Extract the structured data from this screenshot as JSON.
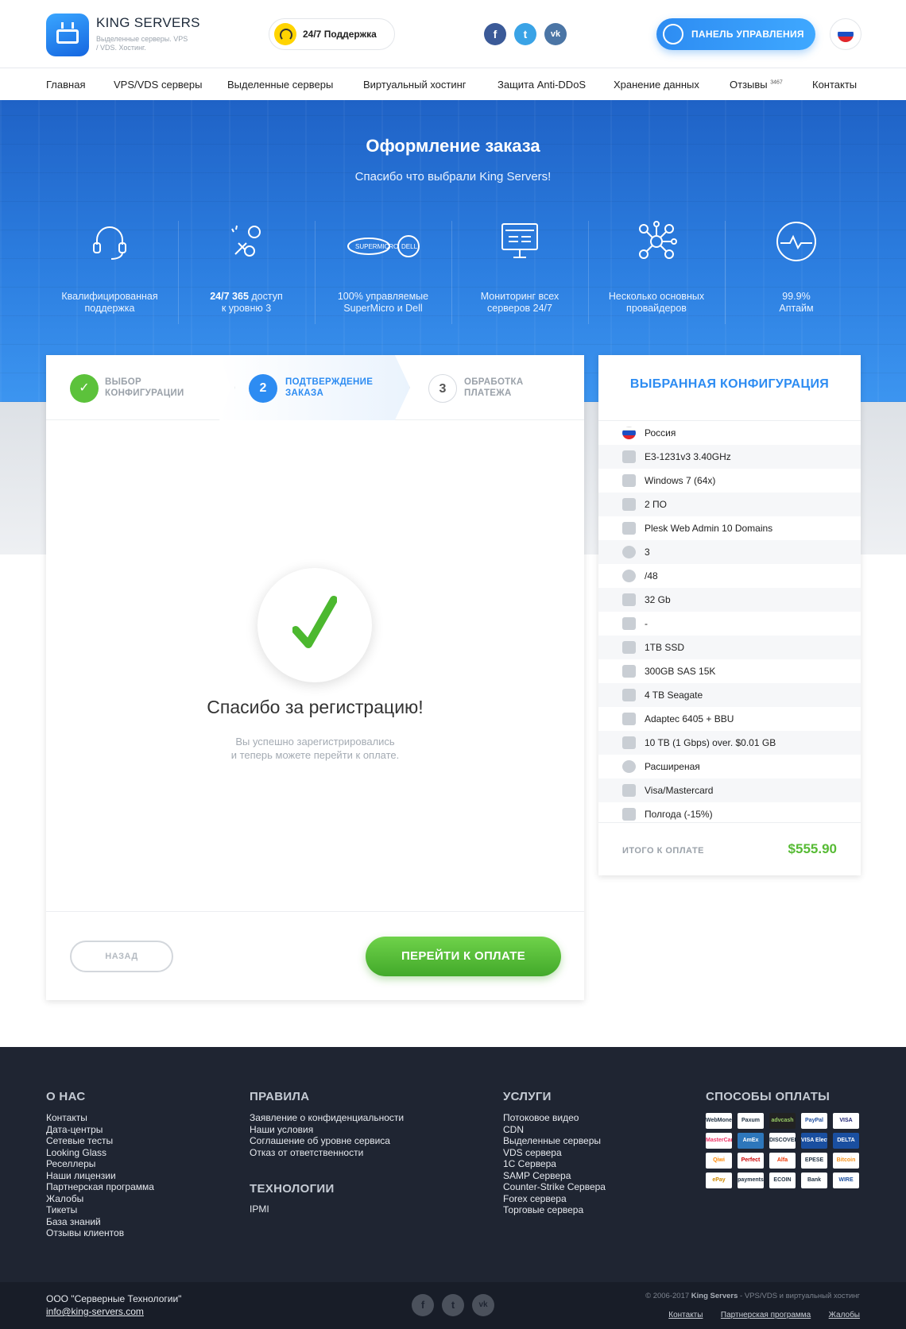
{
  "header": {
    "brand": "KING SERVERS",
    "brand_sub": "Выделенные серверы. VPS / VDS. Хостинг.",
    "support": "24/7 Поддержка",
    "panel_button": "ПАНЕЛЬ УПРАВЛЕНИЯ",
    "social": [
      "f",
      "t",
      "vk"
    ]
  },
  "nav": {
    "items": [
      "Главная",
      "VPS/VDS серверы",
      "Выделенные серверы",
      "Виртуальный хостинг",
      "Защита Anti-DDoS",
      "Хранение данных",
      "Отзывы",
      "Контакты"
    ],
    "reviews_count": "3467"
  },
  "hero": {
    "title": "Оформление заказа",
    "subtitle": "Спасибо что выбрали King Servers!",
    "features": [
      {
        "line1": "Квалифицированная",
        "line2": "поддержка",
        "bold": ""
      },
      {
        "bold": "24/7 365",
        "line1": " доступ",
        "line2": "к уровню 3"
      },
      {
        "line1": "100% управляемые",
        "line2": "SuperMicro и Dell",
        "bold": ""
      },
      {
        "line1": "Мониторинг всех",
        "line2": "серверов 24/7",
        "bold": ""
      },
      {
        "line1": "Несколько основных",
        "line2": "провайдеров",
        "bold": ""
      },
      {
        "line1": "99.9%",
        "line2": "Аптайм",
        "bold": ""
      }
    ]
  },
  "steps": [
    {
      "num": "✓",
      "label1": "ВЫБОР",
      "label2": "КОНФИГУРАЦИИ"
    },
    {
      "num": "2",
      "label1": "ПОДТВЕРЖДЕНИЕ",
      "label2": "ЗАКАЗА"
    },
    {
      "num": "3",
      "label1": "ОБРАБОТКА",
      "label2": "ПЛАТЕЖА"
    }
  ],
  "success": {
    "title": "Спасибо за регистрацию!",
    "line1": "Вы успешно зарегистрировались",
    "line2": "и теперь можете перейти к оплате."
  },
  "buttons": {
    "back": "НАЗАД",
    "pay": "ПЕРЕЙТИ К ОПЛАТЕ"
  },
  "config": {
    "title": "ВЫБРАННАЯ КОНФИГУРАЦИЯ",
    "items": [
      {
        "icon": "flag-russia-icon",
        "value": "Россия"
      },
      {
        "icon": "cpu-icon",
        "value": "E3-1231v3 3.40GHz"
      },
      {
        "icon": "os-icon",
        "value": "Windows 7 (64x)"
      },
      {
        "icon": "software-icon",
        "value": "2 ПО"
      },
      {
        "icon": "panel-icon",
        "value": "Plesk Web Admin 10 Domains"
      },
      {
        "icon": "ip-icon",
        "value": "3"
      },
      {
        "icon": "ipv6-icon",
        "value": "/48"
      },
      {
        "icon": "ram-icon",
        "value": "32 Gb"
      },
      {
        "icon": "disk-icon",
        "value": "-"
      },
      {
        "icon": "ssd-icon",
        "value": "1TB SSD"
      },
      {
        "icon": "sas-icon",
        "value": "300GB SAS 15K"
      },
      {
        "icon": "hdd-icon",
        "value": "4 TB Seagate"
      },
      {
        "icon": "raid-icon",
        "value": "Adaptec 6405 + BBU"
      },
      {
        "icon": "traffic-icon",
        "value": "10 TB (1 Gbps) over. $0.01 GB"
      },
      {
        "icon": "support-icon",
        "value": "Расширеная"
      },
      {
        "icon": "card-icon",
        "value": "Visa/Mastercard"
      },
      {
        "icon": "calendar-icon",
        "value": "Полгода (-15%)"
      }
    ],
    "total_label": "ИТОГО К ОПЛАТЕ",
    "total_value": "$555.90"
  },
  "footer": {
    "about_title": "О НАС",
    "about_links": [
      "Контакты",
      "Дата-центры",
      "Сетевые тесты",
      "Looking Glass",
      "Реселлеры",
      "Наши лицензии",
      "Партнерская программа",
      "Жалобы",
      "Тикеты",
      "База знаний",
      "Отзывы клиентов"
    ],
    "rules_title": "ПРАВИЛА",
    "rules_links": [
      "Заявление о конфиденциальности",
      "Наши условия",
      "Соглашение об уровне сервиса",
      "Отказ от ответственности"
    ],
    "tech_title": "ТЕХНОЛОГИИ",
    "tech_links": [
      "IPMI"
    ],
    "services_title": "УСЛУГИ",
    "services_links": [
      "Потоковое видео",
      "CDN",
      "Выделенные серверы",
      "VDS сервера",
      "1С Сервера",
      "SAMP Сервера",
      "Counter-Strike Сервера",
      "Forex сервера",
      "Торговые сервера"
    ],
    "payments_title": "СПОСОБЫ ОПЛАТЫ",
    "payments": [
      "WebMoney",
      "Paxum",
      "advcash",
      "PayPal",
      "VISA",
      "MasterCard",
      "AmEx",
      "DISCOVER",
      "VISA Electron",
      "DELTA",
      "Qiwi",
      "Perfect",
      "Alfa",
      "EPESE",
      "Bitcoin",
      "ePay",
      "payments",
      "ECOIN",
      "Bank",
      "WIRE"
    ],
    "company": "ООО \"Серверные Технологии\"",
    "email": "info@king-servers.com",
    "copyright_pre": "© 2006-2017 ",
    "copyright_brand": "King Servers",
    "copyright_post": " - VPS/VDS и виртуальный хостинг",
    "bottom_links": [
      "Контакты",
      "Партнерская программа",
      "Жалобы"
    ]
  },
  "colors": {
    "accent": "#2d8cf2",
    "success": "#57bb35",
    "footer_bg": "#1f2532"
  }
}
